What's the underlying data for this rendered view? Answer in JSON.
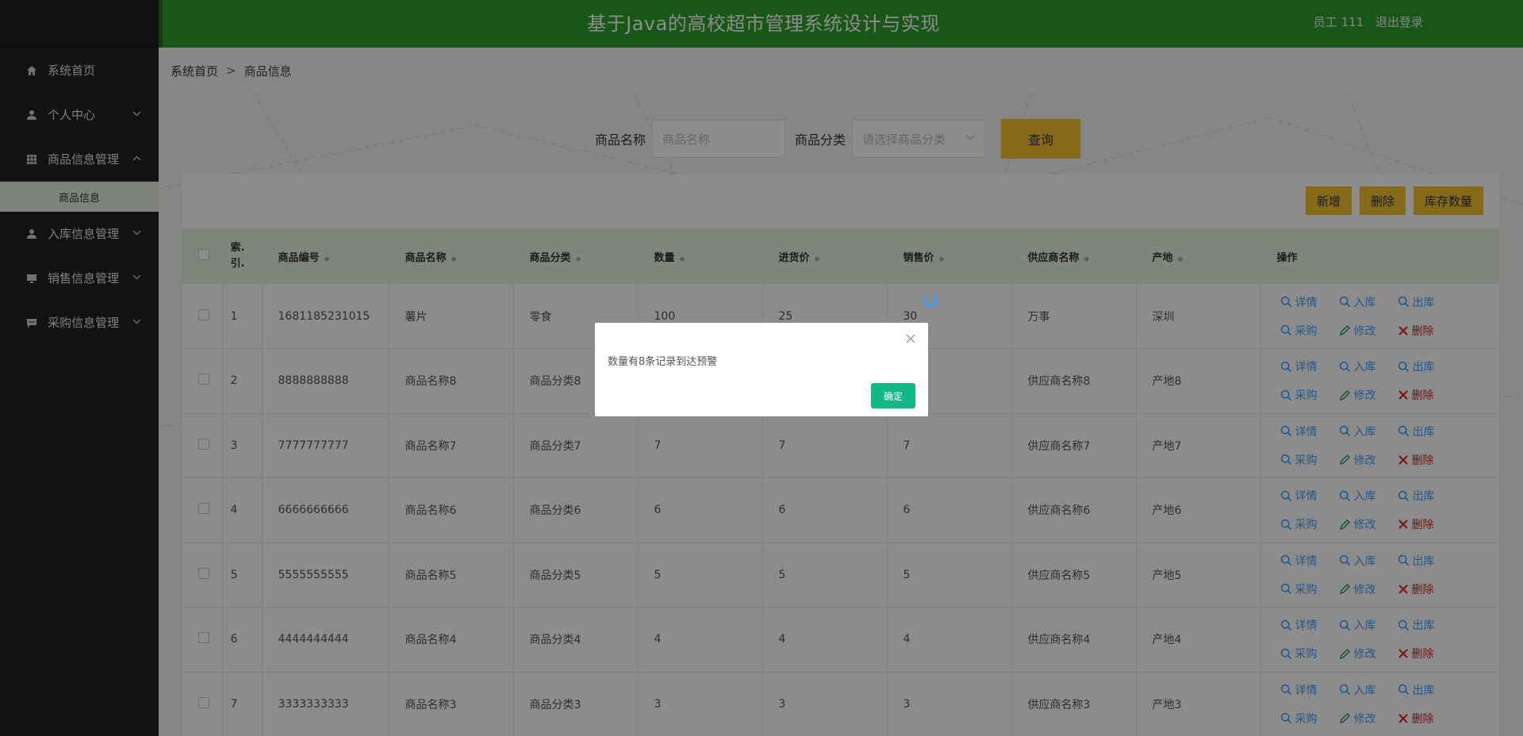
{
  "header": {
    "title": "基于Java的高校超市管理系统设计与实现",
    "user_label": "员工 111",
    "logout_label": "退出登录",
    "accent_color": "#2f9e2f"
  },
  "sidebar": {
    "items": [
      {
        "label": "系统首页",
        "icon": "home-icon"
      },
      {
        "label": "个人中心",
        "icon": "user-icon"
      },
      {
        "label": "商品信息管理",
        "icon": "grid-icon"
      },
      {
        "label": "入库信息管理",
        "icon": "user-icon"
      },
      {
        "label": "销售信息管理",
        "icon": "monitor-icon"
      },
      {
        "label": "采购信息管理",
        "icon": "chat-icon"
      }
    ],
    "submenu": {
      "label": "商品信息"
    }
  },
  "breadcrumb": {
    "home": "系统首页",
    "separator": ">",
    "current": "商品信息"
  },
  "search": {
    "name_label": "商品名称",
    "name_placeholder": "商品名称",
    "category_label": "商品分类",
    "category_placeholder": "请选择商品分类",
    "query_button": "查询"
  },
  "toolbar": {
    "add_label": "新增",
    "delete_label": "删除",
    "stock_label": "库存数量"
  },
  "table": {
    "columns": [
      "索引",
      "商品编号",
      "商品名称",
      "商品分类",
      "数量",
      "进货价",
      "销售价",
      "供应商名称",
      "产地",
      "操作"
    ],
    "index_header_line1": "索.",
    "index_header_line2": "引.",
    "rows": [
      {
        "index": "1",
        "code": "1681185231015",
        "name": "薯片",
        "category": "零食",
        "qty": "100",
        "cost": "25",
        "price": "30",
        "supplier": "万事",
        "origin": "深圳"
      },
      {
        "index": "2",
        "code": "8888888888",
        "name": "商品名称8",
        "category": "商品分类8",
        "qty": "",
        "cost": "",
        "price": "",
        "supplier": "供应商名称8",
        "origin": "产地8"
      },
      {
        "index": "3",
        "code": "7777777777",
        "name": "商品名称7",
        "category": "商品分类7",
        "qty": "7",
        "cost": "7",
        "price": "7",
        "supplier": "供应商名称7",
        "origin": "产地7"
      },
      {
        "index": "4",
        "code": "6666666666",
        "name": "商品名称6",
        "category": "商品分类6",
        "qty": "6",
        "cost": "6",
        "price": "6",
        "supplier": "供应商名称6",
        "origin": "产地6"
      },
      {
        "index": "5",
        "code": "5555555555",
        "name": "商品名称5",
        "category": "商品分类5",
        "qty": "5",
        "cost": "5",
        "price": "5",
        "supplier": "供应商名称5",
        "origin": "产地5"
      },
      {
        "index": "6",
        "code": "4444444444",
        "name": "商品名称4",
        "category": "商品分类4",
        "qty": "4",
        "cost": "4",
        "price": "4",
        "supplier": "供应商名称4",
        "origin": "产地4"
      },
      {
        "index": "7",
        "code": "3333333333",
        "name": "商品名称3",
        "category": "商品分类3",
        "qty": "3",
        "cost": "3",
        "price": "3",
        "supplier": "供应商名称3",
        "origin": "产地3"
      }
    ],
    "ops": {
      "detail": "详情",
      "stock_in": "入库",
      "stock_out": "出库",
      "purchase": "采购",
      "edit": "修改",
      "delete": "删除"
    }
  },
  "modal": {
    "message": "数量有8条记录到达预警",
    "ok_label": "确定"
  }
}
